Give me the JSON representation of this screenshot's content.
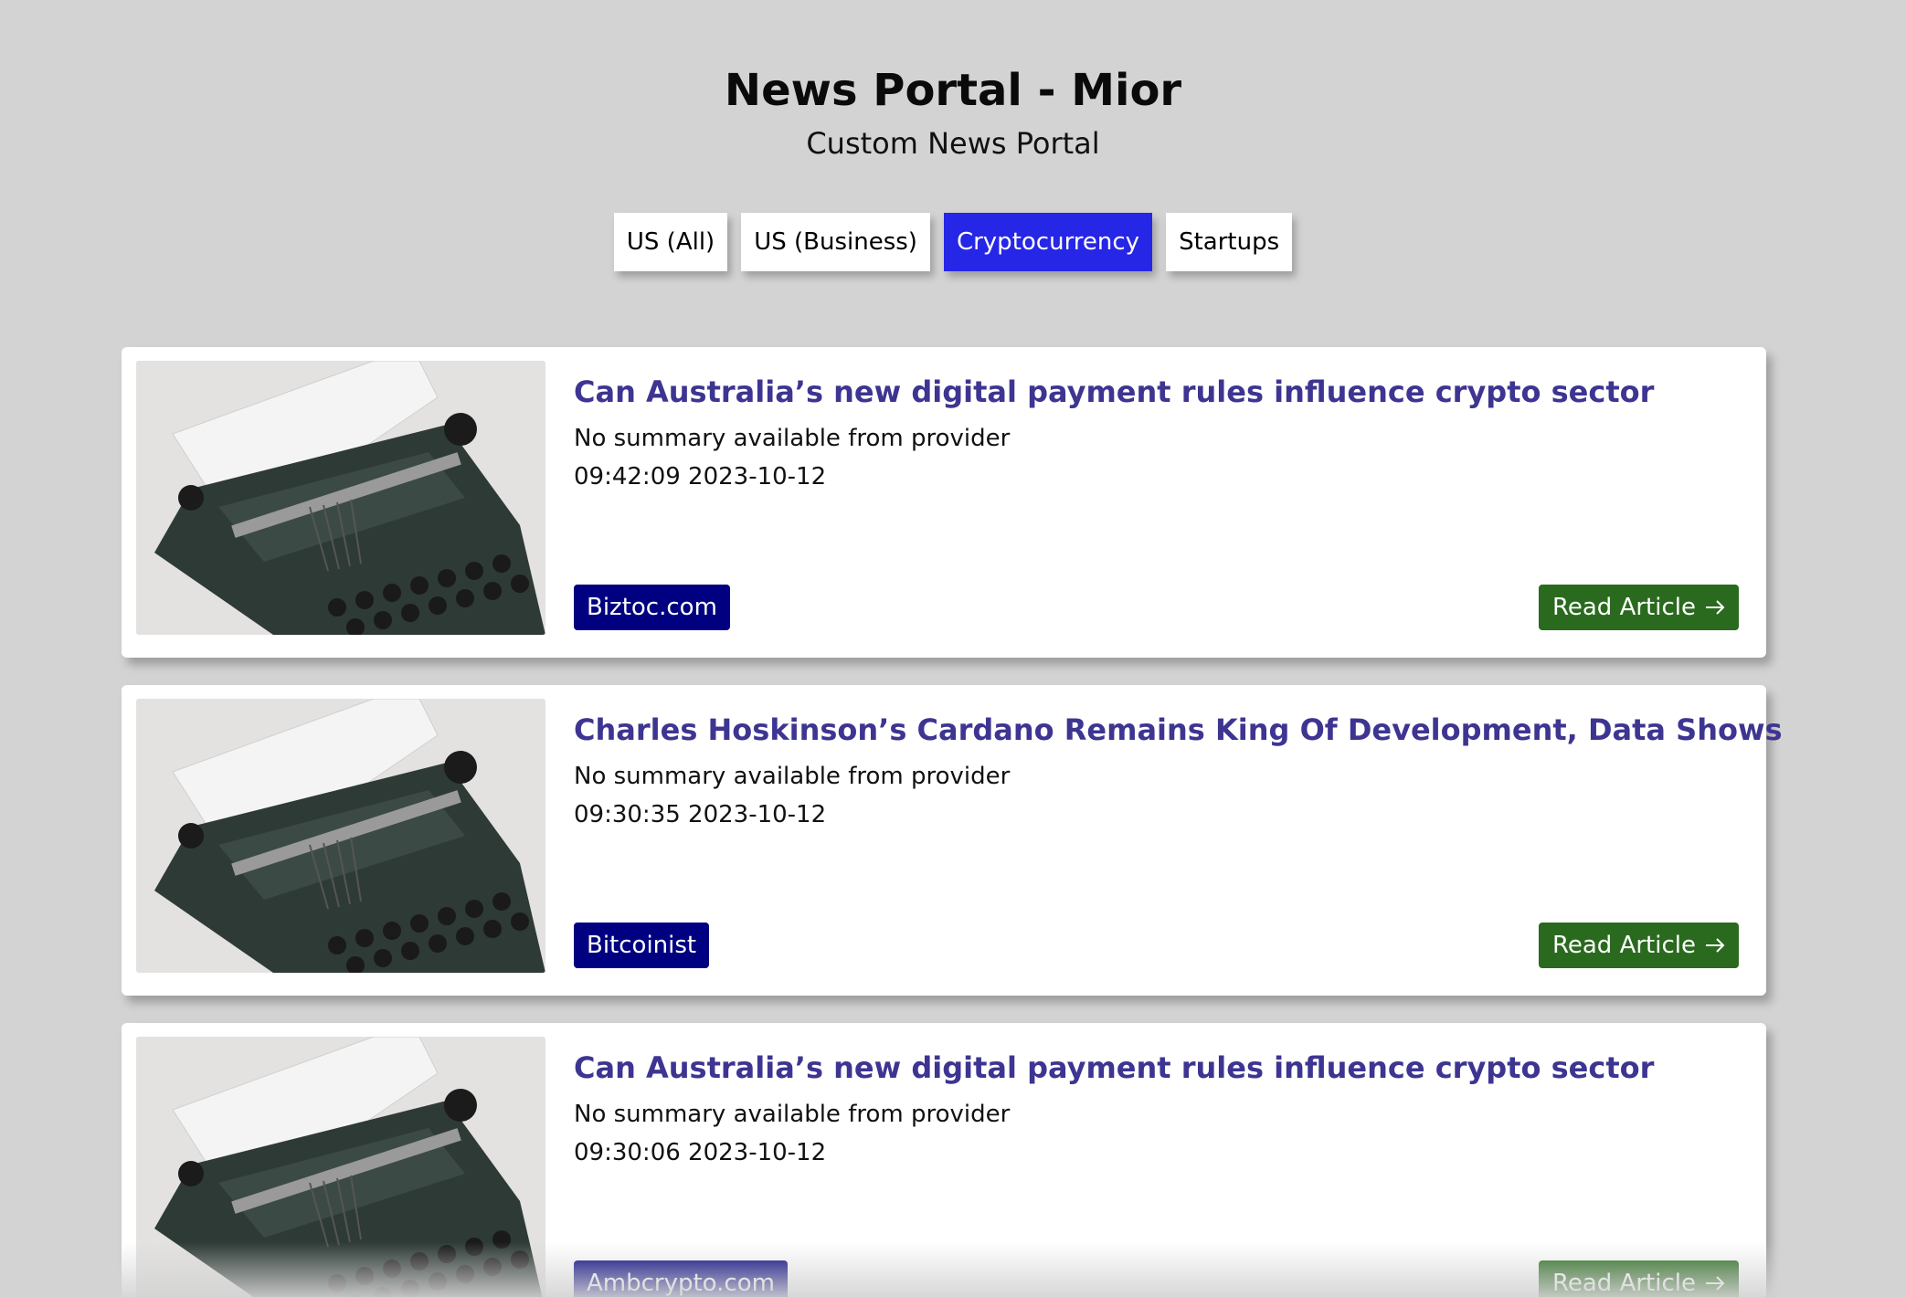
{
  "header": {
    "title": "News Portal - Mior",
    "subtitle": "Custom News Portal"
  },
  "tabs": [
    {
      "label": "US (All)",
      "active": false
    },
    {
      "label": "US (Business)",
      "active": false
    },
    {
      "label": "Cryptocurrency",
      "active": true
    },
    {
      "label": "Startups",
      "active": false
    }
  ],
  "colors": {
    "background": "#d3d3d3",
    "active_tab": "#2626e6",
    "title_text": "#3d3591",
    "source_badge": "#000080",
    "read_button": "#2a6a1e"
  },
  "articles": [
    {
      "title": "Can Australia’s new digital payment rules influence crypto sector",
      "summary": "No summary available from provider",
      "time": "09:42:09 2023-10-12",
      "source": "Biztoc.com",
      "read_label": "Read Article",
      "read_icon": "arrow-right-icon",
      "image": "typewriter-news-image"
    },
    {
      "title": "Charles Hoskinson’s Cardano Remains King Of Development, Data Shows",
      "summary": "No summary available from provider",
      "time": "09:30:35 2023-10-12",
      "source": "Bitcoinist",
      "read_label": "Read Article",
      "read_icon": "arrow-right-icon",
      "image": "typewriter-news-image"
    },
    {
      "title": "Can Australia’s new digital payment rules influence crypto sector",
      "summary": "No summary available from provider",
      "time": "09:30:06 2023-10-12",
      "source": "Ambcrypto.com",
      "read_label": "Read Article",
      "read_icon": "arrow-right-icon",
      "image": "typewriter-news-image"
    }
  ]
}
